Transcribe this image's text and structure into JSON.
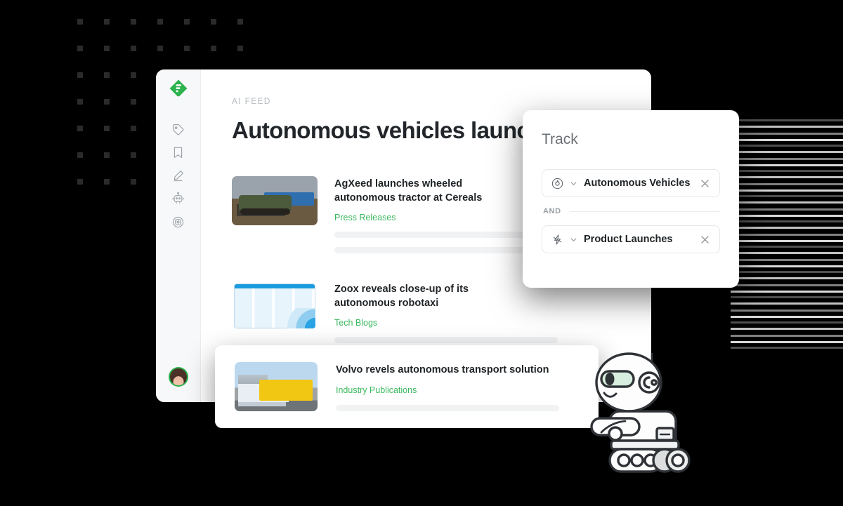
{
  "app": {
    "name": "Feedly AI Feed",
    "logo_icon": "feedly-logo-icon",
    "brand_green": "#2bb24c",
    "source_link_color": "#3cb95f"
  },
  "sidebar": {
    "items": [
      {
        "icon": "tag-icon",
        "label": "Tags"
      },
      {
        "icon": "bookmark-icon",
        "label": "Read Later"
      },
      {
        "icon": "pencil-icon",
        "label": "Highlights"
      },
      {
        "icon": "robot-icon",
        "label": "Leo AI"
      },
      {
        "icon": "target-icon",
        "label": "Boards"
      }
    ],
    "avatar_label": "User avatar"
  },
  "main": {
    "eyebrow": "AI FEED",
    "headline": "Autonomous vehicles launch",
    "articles": [
      {
        "title": "AgXeed launches wheeled autonomous tractor at Cereals",
        "source": "Press Releases",
        "thumb": "tractor-in-field-thumbnail",
        "skeleton_lines": 2
      },
      {
        "title": "Zoox reveals close-up of its autonomous robotaxi",
        "source": "Tech Blogs",
        "thumb": "blue-dashboard-thumbnail",
        "skeleton_lines": 2
      }
    ]
  },
  "float_card": {
    "title": "Volvo revels autonomous transport solution",
    "source": "Industry Publications",
    "thumb": "volvo-truck-thumbnail",
    "skeleton_lines": 1
  },
  "track_panel": {
    "title": "Track",
    "operator": "AND",
    "chips": [
      {
        "icon": "flame-circle-icon",
        "label": "Autonomous Vehicles",
        "chevron": "chevron-down-icon",
        "close": "close-icon"
      },
      {
        "icon": "lightning-bolt-icon",
        "label": "Product Launches",
        "chevron": "chevron-down-icon",
        "close": "close-icon"
      }
    ]
  },
  "decor": {
    "robot": "robot-mascot-illustration",
    "dot_grid": "dot-grid-pattern"
  }
}
